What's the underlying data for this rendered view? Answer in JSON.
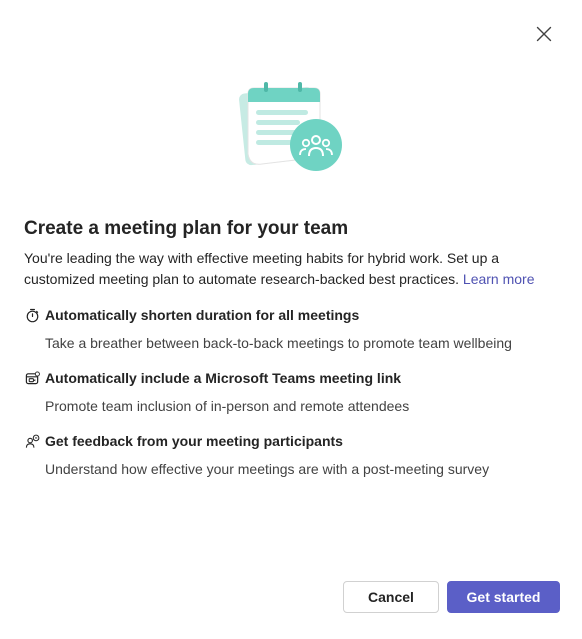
{
  "dialog": {
    "title": "Create a meeting plan for your team",
    "description": "You're leading the way with effective meeting habits for hybrid work. Set up a customized meeting plan to automate research-backed best practices.",
    "learn_more": "Learn more"
  },
  "features": [
    {
      "icon": "timer-icon",
      "title": "Automatically shorten duration for all meetings",
      "description": "Take a breather between back-to-back meetings to promote team wellbeing"
    },
    {
      "icon": "teams-meeting-icon",
      "title": "Automatically include a Microsoft Teams meeting link",
      "description": "Promote team inclusion of in-person and remote attendees"
    },
    {
      "icon": "feedback-people-icon",
      "title": "Get feedback from your meeting participants",
      "description": "Understand how effective your meetings are with a post-meeting survey"
    }
  ],
  "buttons": {
    "cancel": "Cancel",
    "primary": "Get started"
  },
  "colors": {
    "accent": "#5b5fc7",
    "link": "#4f52b2",
    "illustration_teal": "#6fd3c3"
  }
}
